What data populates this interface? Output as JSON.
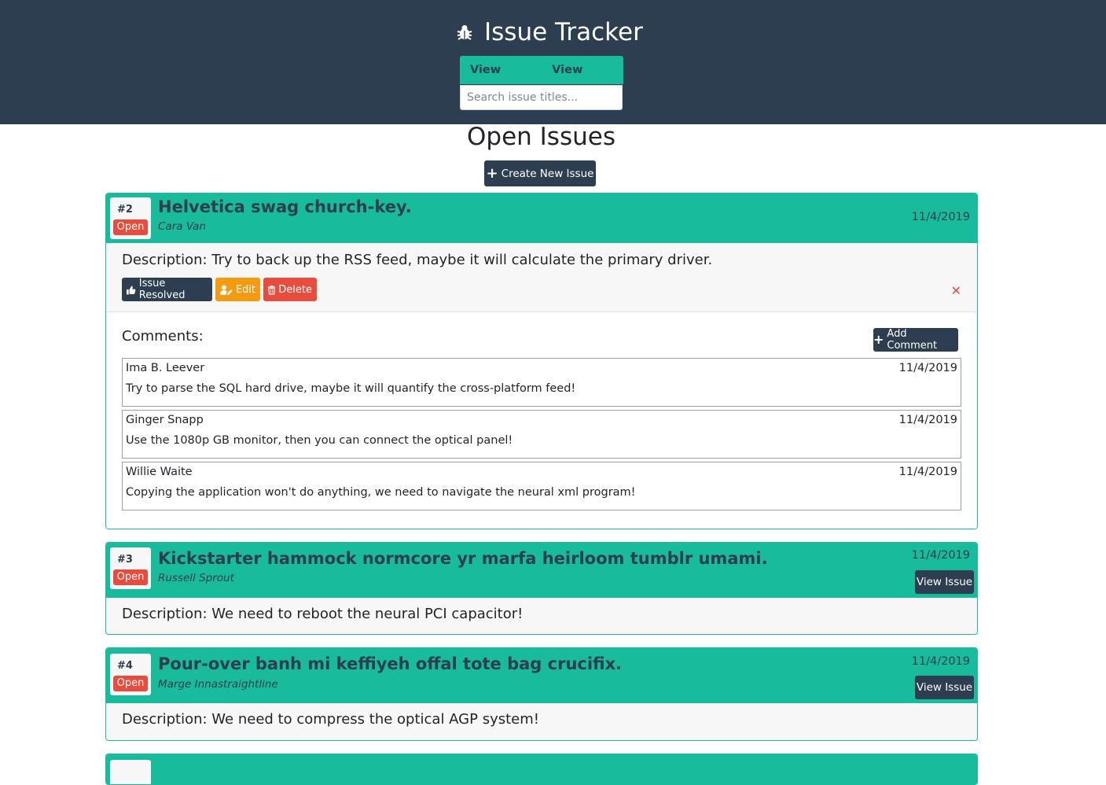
{
  "header": {
    "app_title": "Issue Tracker",
    "icon": "bug-icon",
    "tabs": [
      {
        "label": "View Open"
      },
      {
        "label": "View Closed"
      }
    ],
    "search_placeholder": "Search issue titles..."
  },
  "main": {
    "page_title": "Open Issues",
    "create_button": "Create New Issue",
    "issues": [
      {
        "number": "#2",
        "status": "Open",
        "title": "Helvetica swag church-key.",
        "author": "Cara Van",
        "date": "11/4/2019",
        "description": "Description: Try to back up the RSS feed, maybe it will calculate the primary driver.",
        "actions": {
          "resolve": "Issue Resolved",
          "edit": "Edit",
          "delete": "Delete"
        },
        "comments_label": "Comments:",
        "add_comment": "Add Comment",
        "comments": [
          {
            "author": "Ima B. Leever",
            "date": "11/4/2019",
            "text": "Try to parse the SQL hard drive, maybe it will quantify the cross-platform feed!"
          },
          {
            "author": "Ginger Snapp",
            "date": "11/4/2019",
            "text": "Use the 1080p GB monitor, then you can connect the optical panel!"
          },
          {
            "author": "Willie Waite",
            "date": "11/4/2019",
            "text": "Copying the application won't do anything, we need to navigate the neural xml program!"
          }
        ]
      },
      {
        "number": "#3",
        "status": "Open",
        "title": "Kickstarter hammock normcore yr marfa heirloom tumblr umami.",
        "author": "Russell Sprout",
        "date": "11/4/2019",
        "view_button": "View Issue",
        "description": "Description: We need to reboot the neural PCI capacitor!"
      },
      {
        "number": "#4",
        "status": "Open",
        "title": "Pour-over banh mi keffiyeh offal tote bag crucifix.",
        "author": "Marge Innastraightline",
        "date": "11/4/2019",
        "view_button": "View Issue",
        "description": "Description: We need to compress the optical AGP system!"
      }
    ]
  },
  "colors": {
    "navy": "#2c3e50",
    "teal": "#18bc9c",
    "danger": "#e74c3c",
    "warning": "#f39c12"
  }
}
